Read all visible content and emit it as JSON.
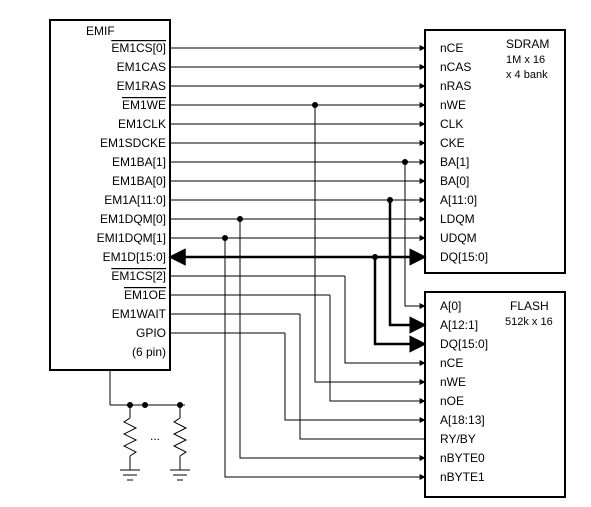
{
  "left_block": {
    "title": "EMIF",
    "pins": [
      "EM1CS[0]",
      "EM1CAS",
      "EM1RAS",
      "EM1WE",
      "EM1CLK",
      "EM1SDCKE",
      "EM1BA[1]",
      "EM1BA[0]",
      "EM1A[11:0]",
      "EM1DQM[0]",
      "EMI1DQM[1]",
      "EM1D[15:0]",
      "EM1CS[2]",
      "EM1OE",
      "EM1WAIT",
      "GPIO",
      "(6 pin)"
    ]
  },
  "sdram_block": {
    "title": "SDRAM",
    "subtitle1": "1M x 16",
    "subtitle2": "x 4 bank",
    "pins": [
      "nCE",
      "nCAS",
      "nRAS",
      "nWE",
      "CLK",
      "CKE",
      "BA[1]",
      "BA[0]",
      "A[11:0]",
      "LDQM",
      "UDQM",
      "DQ[15:0]"
    ]
  },
  "flash_block": {
    "title": "FLASH",
    "subtitle1": "512k x 16",
    "pins": [
      "A[0]",
      "A[12:1]",
      "DQ[15:0]",
      "nCE",
      "nWE",
      "nOE",
      "A[18:13]",
      "RY/BY",
      "nBYTE0",
      "nBYTE1"
    ]
  },
  "resistor_note": "...",
  "chart_data": {
    "type": "wiring-diagram",
    "blocks": [
      {
        "name": "EMIF",
        "pins": [
          "EM1CS[0]",
          "EM1CAS",
          "EM1RAS",
          "EM1WE",
          "EM1CLK",
          "EM1SDCKE",
          "EM1BA[1]",
          "EM1BA[0]",
          "EM1A[11:0]",
          "EM1DQM[0]",
          "EMI1DQM[1]",
          "EM1D[15:0]",
          "EM1CS[2]",
          "EM1OE",
          "EM1WAIT",
          "GPIO(6 pin)"
        ]
      },
      {
        "name": "SDRAM 1M x 16 x 4 bank",
        "pins": [
          "nCE",
          "nCAS",
          "nRAS",
          "nWE",
          "CLK",
          "CKE",
          "BA[1]",
          "BA[0]",
          "A[11:0]",
          "LDQM",
          "UDQM",
          "DQ[15:0]"
        ]
      },
      {
        "name": "FLASH 512k x 16",
        "pins": [
          "A[0]",
          "A[12:1]",
          "DQ[15:0]",
          "nCE",
          "nWE",
          "nOE",
          "A[18:13]",
          "RY/BY",
          "nBYTE0",
          "nBYTE1"
        ]
      }
    ],
    "connections_emif_sdram": [
      [
        "EM1CS[0]",
        "nCE"
      ],
      [
        "EM1CAS",
        "nCAS"
      ],
      [
        "EM1RAS",
        "nRAS"
      ],
      [
        "EM1WE",
        "nWE"
      ],
      [
        "EM1CLK",
        "CLK"
      ],
      [
        "EM1SDCKE",
        "CKE"
      ],
      [
        "EM1BA[1]",
        "BA[1]"
      ],
      [
        "EM1BA[0]",
        "BA[0]"
      ],
      [
        "EM1A[11:0]",
        "A[11:0]"
      ],
      [
        "EM1DQM[0]",
        "LDQM"
      ],
      [
        "EMI1DQM[1]",
        "UDQM"
      ],
      [
        "EM1D[15:0]",
        "DQ[15:0]"
      ]
    ],
    "connections_emif_flash": [
      [
        "EM1BA[1]",
        "A[0]"
      ],
      [
        "EM1A[11:0]",
        "A[12:1]"
      ],
      [
        "EM1D[15:0]",
        "DQ[15:0]"
      ],
      [
        "EM1CS[2]",
        "nCE"
      ],
      [
        "EM1WE",
        "nWE"
      ],
      [
        "EM1OE",
        "nOE"
      ],
      [
        "GPIO(6 pin)",
        "A[18:13]"
      ],
      [
        "EM1WAIT",
        "RY/BY"
      ],
      [
        "EM1DQM[0]",
        "nBYTE0"
      ],
      [
        "EMI1DQM[1]",
        "nBYTE1"
      ]
    ],
    "pulldowns": [
      "EM1D[15:0]"
    ]
  }
}
